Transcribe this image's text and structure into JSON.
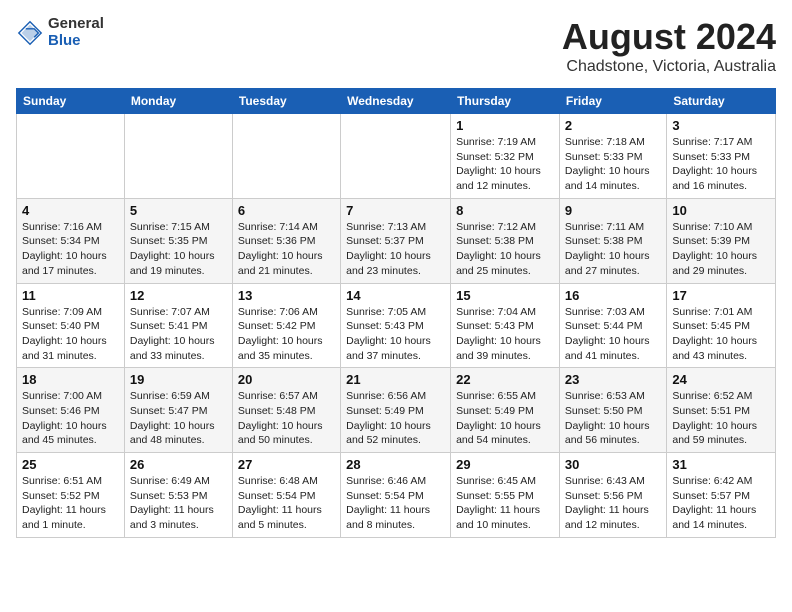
{
  "header": {
    "logo_general": "General",
    "logo_blue": "Blue",
    "main_title": "August 2024",
    "subtitle": "Chadstone, Victoria, Australia"
  },
  "calendar": {
    "days_of_week": [
      "Sunday",
      "Monday",
      "Tuesday",
      "Wednesday",
      "Thursday",
      "Friday",
      "Saturday"
    ],
    "weeks": [
      [
        {
          "day": "",
          "info": ""
        },
        {
          "day": "",
          "info": ""
        },
        {
          "day": "",
          "info": ""
        },
        {
          "day": "",
          "info": ""
        },
        {
          "day": "1",
          "info": "Sunrise: 7:19 AM\nSunset: 5:32 PM\nDaylight: 10 hours and 12 minutes."
        },
        {
          "day": "2",
          "info": "Sunrise: 7:18 AM\nSunset: 5:33 PM\nDaylight: 10 hours and 14 minutes."
        },
        {
          "day": "3",
          "info": "Sunrise: 7:17 AM\nSunset: 5:33 PM\nDaylight: 10 hours and 16 minutes."
        }
      ],
      [
        {
          "day": "4",
          "info": "Sunrise: 7:16 AM\nSunset: 5:34 PM\nDaylight: 10 hours and 17 minutes."
        },
        {
          "day": "5",
          "info": "Sunrise: 7:15 AM\nSunset: 5:35 PM\nDaylight: 10 hours and 19 minutes."
        },
        {
          "day": "6",
          "info": "Sunrise: 7:14 AM\nSunset: 5:36 PM\nDaylight: 10 hours and 21 minutes."
        },
        {
          "day": "7",
          "info": "Sunrise: 7:13 AM\nSunset: 5:37 PM\nDaylight: 10 hours and 23 minutes."
        },
        {
          "day": "8",
          "info": "Sunrise: 7:12 AM\nSunset: 5:38 PM\nDaylight: 10 hours and 25 minutes."
        },
        {
          "day": "9",
          "info": "Sunrise: 7:11 AM\nSunset: 5:38 PM\nDaylight: 10 hours and 27 minutes."
        },
        {
          "day": "10",
          "info": "Sunrise: 7:10 AM\nSunset: 5:39 PM\nDaylight: 10 hours and 29 minutes."
        }
      ],
      [
        {
          "day": "11",
          "info": "Sunrise: 7:09 AM\nSunset: 5:40 PM\nDaylight: 10 hours and 31 minutes."
        },
        {
          "day": "12",
          "info": "Sunrise: 7:07 AM\nSunset: 5:41 PM\nDaylight: 10 hours and 33 minutes."
        },
        {
          "day": "13",
          "info": "Sunrise: 7:06 AM\nSunset: 5:42 PM\nDaylight: 10 hours and 35 minutes."
        },
        {
          "day": "14",
          "info": "Sunrise: 7:05 AM\nSunset: 5:43 PM\nDaylight: 10 hours and 37 minutes."
        },
        {
          "day": "15",
          "info": "Sunrise: 7:04 AM\nSunset: 5:43 PM\nDaylight: 10 hours and 39 minutes."
        },
        {
          "day": "16",
          "info": "Sunrise: 7:03 AM\nSunset: 5:44 PM\nDaylight: 10 hours and 41 minutes."
        },
        {
          "day": "17",
          "info": "Sunrise: 7:01 AM\nSunset: 5:45 PM\nDaylight: 10 hours and 43 minutes."
        }
      ],
      [
        {
          "day": "18",
          "info": "Sunrise: 7:00 AM\nSunset: 5:46 PM\nDaylight: 10 hours and 45 minutes."
        },
        {
          "day": "19",
          "info": "Sunrise: 6:59 AM\nSunset: 5:47 PM\nDaylight: 10 hours and 48 minutes."
        },
        {
          "day": "20",
          "info": "Sunrise: 6:57 AM\nSunset: 5:48 PM\nDaylight: 10 hours and 50 minutes."
        },
        {
          "day": "21",
          "info": "Sunrise: 6:56 AM\nSunset: 5:49 PM\nDaylight: 10 hours and 52 minutes."
        },
        {
          "day": "22",
          "info": "Sunrise: 6:55 AM\nSunset: 5:49 PM\nDaylight: 10 hours and 54 minutes."
        },
        {
          "day": "23",
          "info": "Sunrise: 6:53 AM\nSunset: 5:50 PM\nDaylight: 10 hours and 56 minutes."
        },
        {
          "day": "24",
          "info": "Sunrise: 6:52 AM\nSunset: 5:51 PM\nDaylight: 10 hours and 59 minutes."
        }
      ],
      [
        {
          "day": "25",
          "info": "Sunrise: 6:51 AM\nSunset: 5:52 PM\nDaylight: 11 hours and 1 minute."
        },
        {
          "day": "26",
          "info": "Sunrise: 6:49 AM\nSunset: 5:53 PM\nDaylight: 11 hours and 3 minutes."
        },
        {
          "day": "27",
          "info": "Sunrise: 6:48 AM\nSunset: 5:54 PM\nDaylight: 11 hours and 5 minutes."
        },
        {
          "day": "28",
          "info": "Sunrise: 6:46 AM\nSunset: 5:54 PM\nDaylight: 11 hours and 8 minutes."
        },
        {
          "day": "29",
          "info": "Sunrise: 6:45 AM\nSunset: 5:55 PM\nDaylight: 11 hours and 10 minutes."
        },
        {
          "day": "30",
          "info": "Sunrise: 6:43 AM\nSunset: 5:56 PM\nDaylight: 11 hours and 12 minutes."
        },
        {
          "day": "31",
          "info": "Sunrise: 6:42 AM\nSunset: 5:57 PM\nDaylight: 11 hours and 14 minutes."
        }
      ]
    ]
  }
}
